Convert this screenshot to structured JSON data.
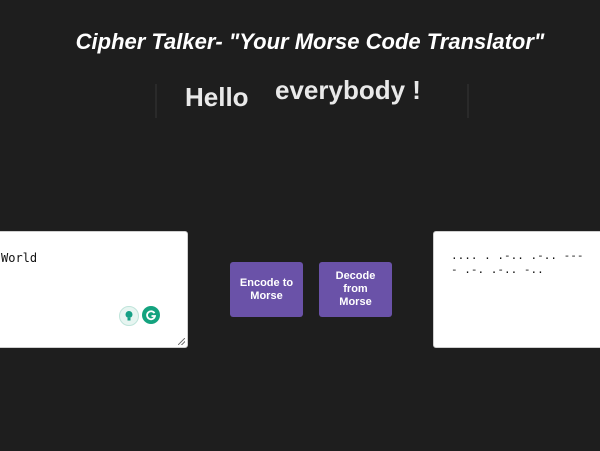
{
  "header": {
    "title": "Cipher Talker- \"Your Morse Code Translator\""
  },
  "banner": {
    "word1": "Hello",
    "word2": "everybody !"
  },
  "input": {
    "value": "World"
  },
  "buttons": {
    "encode_label": "Encode to Morse",
    "decode_label": "Decode from Morse"
  },
  "output": {
    "line1": ".... . .-.. .-.. ---",
    "line2": "- .-. .-.. -.."
  },
  "extension_icons": [
    "lightbulb-icon",
    "grammarly-icon"
  ],
  "colors": {
    "background": "#1e1e1e",
    "button": "#6a52a8",
    "grammarly": "#14a37f"
  }
}
